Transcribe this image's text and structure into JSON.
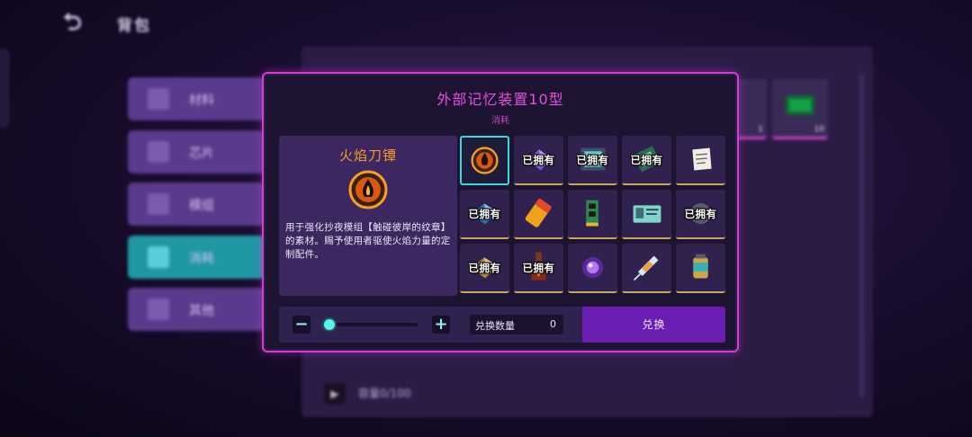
{
  "header": {
    "back_icon": "back-arrow-icon",
    "title": "背包"
  },
  "categories": [
    {
      "label": "材料",
      "icon": "materials-icon",
      "active": false
    },
    {
      "label": "芯片",
      "icon": "chip-icon",
      "active": false
    },
    {
      "label": "模组",
      "icon": "module-icon",
      "active": false
    },
    {
      "label": "消耗",
      "icon": "consumable-icon",
      "active": true
    },
    {
      "label": "其他",
      "icon": "other-icon",
      "active": false
    }
  ],
  "background_panel": {
    "slots": [
      {
        "count": "1"
      },
      {
        "count": "10"
      }
    ],
    "capacity_text": "容量0/100"
  },
  "popup": {
    "title": "外部记忆装置10型",
    "subtitle": "消耗",
    "detail": {
      "name": "火焰刀镡",
      "icon": "flame-tsuba-icon",
      "description": "用于强化抄夜模组【触碰彼岸的纹章】的素材。赐予使用者驱使火焰力量的定制配件。"
    },
    "items": [
      {
        "name": "flame-tsuba",
        "owned": false,
        "selected": true
      },
      {
        "name": "purple-crystal",
        "owned": true,
        "owned_label": "已拥有"
      },
      {
        "name": "tech-module",
        "owned": true,
        "owned_label": "已拥有"
      },
      {
        "name": "green-circuit",
        "owned": true,
        "owned_label": "已拥有"
      },
      {
        "name": "paper-note",
        "owned": false
      },
      {
        "name": "blue-cube",
        "owned": true,
        "owned_label": "已拥有"
      },
      {
        "name": "battery",
        "owned": false
      },
      {
        "name": "ram-stick",
        "owned": false
      },
      {
        "name": "id-card",
        "owned": false
      },
      {
        "name": "gear-part",
        "owned": true,
        "owned_label": "已拥有"
      },
      {
        "name": "gold-crystal",
        "owned": true,
        "owned_label": "已拥有"
      },
      {
        "name": "flame-bottle",
        "owned": true,
        "owned_label": "已拥有"
      },
      {
        "name": "purple-orb",
        "owned": false
      },
      {
        "name": "syringe",
        "owned": false
      },
      {
        "name": "canister",
        "owned": false
      }
    ],
    "quantity": {
      "minus_label": "−",
      "plus_label": "+",
      "slider_value_fraction": 0,
      "label": "兑换数量",
      "value": "0"
    },
    "exchange_label": "兑换"
  },
  "colors": {
    "accent_magenta": "#d83ad8",
    "selection_cyan": "#37dcd8",
    "item_name_orange": "#f39a2a",
    "exchange_purple": "#6a1fb2"
  }
}
